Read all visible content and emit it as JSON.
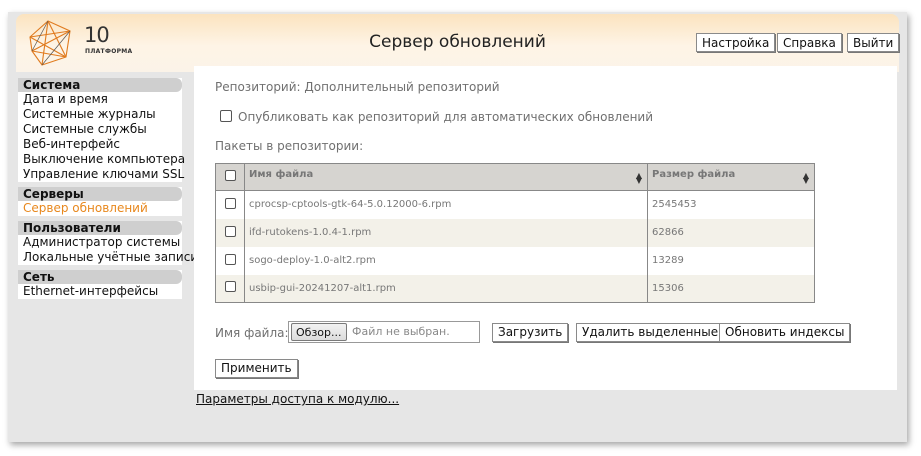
{
  "header": {
    "logo_number": "10",
    "logo_brand": "ПЛАТФОРМА",
    "title": "Сервер обновлений",
    "buttons": {
      "settings": "Настройка",
      "help": "Справка",
      "logout": "Выйти"
    }
  },
  "sidebar": {
    "groups": [
      {
        "title": "Система",
        "items": [
          "Дата и время",
          "Системные журналы",
          "Системные службы",
          "Веб-интерфейс",
          "Выключение компьютера",
          "Управление ключами SSL"
        ]
      },
      {
        "title": "Серверы",
        "items": [
          "Сервер обновлений"
        ]
      },
      {
        "title": "Пользователи",
        "items": [
          "Администратор системы",
          "Локальные учётные записи"
        ]
      },
      {
        "title": "Сеть",
        "items": [
          "Ethernet-интерфейсы"
        ]
      }
    ],
    "active_item": "Сервер обновлений"
  },
  "main": {
    "repository_line": "Репозиторий: Дополнительный репозиторий",
    "publish_label": "Опубликовать как репозиторий для автоматических обновлений",
    "publish_checked": false,
    "packages_label": "Пакеты в репозитории:",
    "table": {
      "columns": [
        "Имя файла",
        "Размер файла"
      ],
      "rows": [
        {
          "name": "cprocsp-cptools-gtk-64-5.0.12000-6.rpm",
          "size": "2545453"
        },
        {
          "name": "ifd-rutokens-1.0.4-1.rpm",
          "size": "62866"
        },
        {
          "name": "sogo-deploy-1.0-alt2.rpm",
          "size": "13289"
        },
        {
          "name": "usbip-gui-20241207-alt1.rpm",
          "size": "15306"
        }
      ]
    },
    "file_label": "Имя файла:",
    "browse_button": "Обзор...",
    "no_file_text": "Файл не выбран.",
    "upload_button": "Загрузить",
    "delete_button": "Удалить выделенные",
    "reindex_button": "Обновить индексы",
    "apply_button": "Применить"
  },
  "footer": {
    "access_link": "Параметры доступа к модулю..."
  },
  "colors": {
    "active_link": "#e8881e",
    "header_gradient_top": "#fbe3bf",
    "sidebar_heading_bg": "#cfcfcf",
    "table_header_bg": "#d6d4d0",
    "table_even_row_bg": "#f3f1e9"
  }
}
